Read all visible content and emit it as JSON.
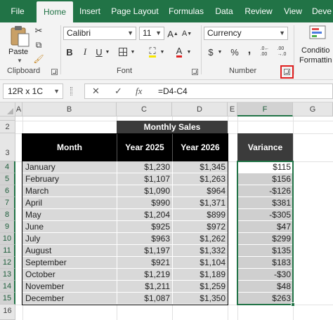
{
  "ribbon_tabs": [
    "File",
    "Home",
    "Insert",
    "Page Layout",
    "Formulas",
    "Data",
    "Review",
    "View",
    "Deve"
  ],
  "active_tab": "Home",
  "clipboard": {
    "paste_label": "Paste",
    "group_label": "Clipboard"
  },
  "font": {
    "name": "Calibri",
    "size": "11",
    "group_label": "Font",
    "bold": "B",
    "italic": "I",
    "underline": "U",
    "grow": "A",
    "shrink": "A",
    "font_color": "A"
  },
  "number": {
    "format": "Currency",
    "group_label": "Number",
    "currency_symbol": "$",
    "percent_symbol": "%",
    "comma_symbol": ",",
    "dec_increase": ".0←\n.00",
    "dec_decrease": ".00\n→.0"
  },
  "styles": {
    "conditional_line1": "Conditio",
    "conditional_line2": "Formattin"
  },
  "formula_bar": {
    "name_box": "12R x 1C",
    "fx": "fx",
    "formula": "=D4-C4"
  },
  "columns": [
    "A",
    "B",
    "C",
    "D",
    "E",
    "F",
    "G"
  ],
  "rows": [
    "1",
    "2",
    "3",
    "4",
    "5",
    "6",
    "7",
    "8",
    "9",
    "10",
    "11",
    "12",
    "13",
    "14",
    "15",
    "16"
  ],
  "table": {
    "merged_header": "Monthly Sales",
    "month_header": "Month",
    "year1_header": "Year 2025",
    "year2_header": "Year 2026",
    "variance_header": "Variance",
    "months": [
      "January",
      "February",
      "March",
      "April",
      "May",
      "June",
      "July",
      "August",
      "September",
      "October",
      "November",
      "December"
    ],
    "year1": [
      "$1,230",
      "$1,107",
      "$1,090",
      "$990",
      "$1,204",
      "$925",
      "$963",
      "$1,197",
      "$921",
      "$1,219",
      "$1,211",
      "$1,087"
    ],
    "year2": [
      "$1,345",
      "$1,263",
      "$964",
      "$1,371",
      "$899",
      "$972",
      "$1,262",
      "$1,332",
      "$1,104",
      "$1,189",
      "$1,259",
      "$1,350"
    ],
    "variance": [
      "$115",
      "$156",
      "-$126",
      "$381",
      "-$305",
      "$47",
      "$299",
      "$135",
      "$183",
      "-$30",
      "$48",
      "$263"
    ]
  }
}
